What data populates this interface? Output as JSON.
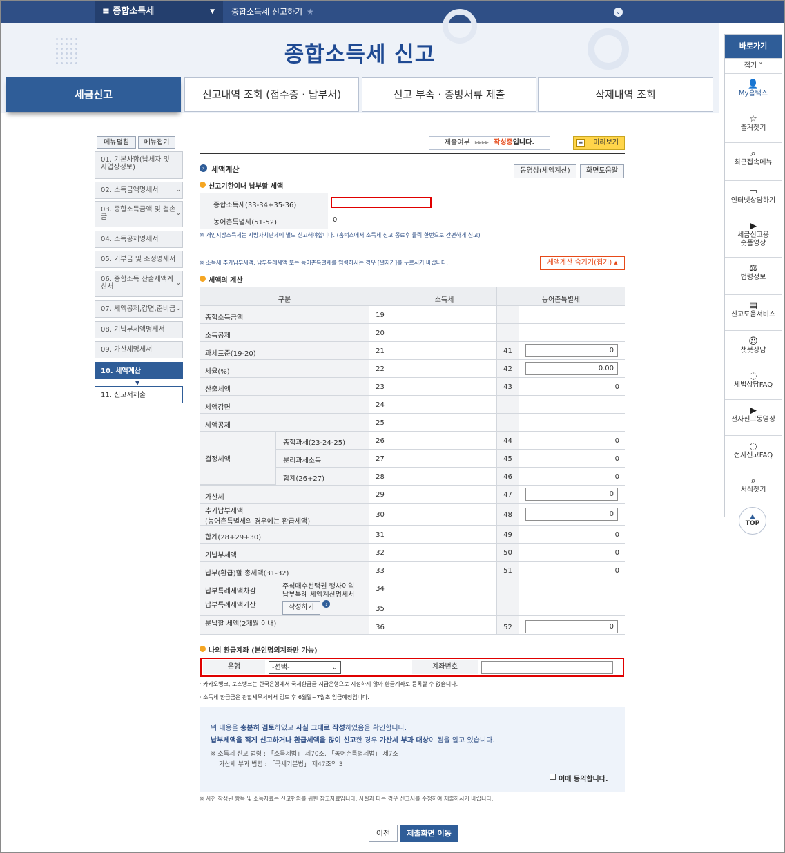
{
  "topbar": {
    "menu": "종합소득세",
    "crumb": "종합소득세 신고하기"
  },
  "title": "종합소득세 신고",
  "tabs": [
    "세금신고",
    "신고내역 조회 (접수증 · 납부서)",
    "신고 부속 · 증빙서류 제출",
    "삭제내역 조회"
  ],
  "side_buttons": {
    "edit": "메뉴펼침",
    "fold": "메뉴접기"
  },
  "side_items": [
    "01. 기본사항(납세자 및 사업장정보)",
    "02. 소득금액명세서",
    "03. 종합소득금액 및 결손금",
    "04. 소득공제명세서",
    "05. 기부금 및 조정명세서",
    "06. 종합소득 산출세액계산서",
    "07. 세액공제,감면,준비금",
    "08. 기납부세액명세서",
    "09. 가산세명세서",
    "10. 세액계산",
    "11. 신고서제출"
  ],
  "status": {
    "label": "제출여부",
    "arrows": "▸▸▸▸",
    "state": "작성중",
    "suffix": "입니다.",
    "preview": "미리보기"
  },
  "section": {
    "title": "세액계산",
    "video_btn": "동영상(세액계산)",
    "help_btn": "화면도움말"
  },
  "due": {
    "title": "신고기한이내 납부할 세액",
    "rows": [
      {
        "label": "종합소득세(33-34+35-36)",
        "value": ""
      },
      {
        "label": "농어촌특별세(51-52)",
        "value": "0"
      }
    ],
    "note": "※ 개인지방소득세는 지방자치단체에 별도 신고해야합니다. (홈택스에서 소득세 신고 종료후 클릭 한번으로 간편하게 신고)"
  },
  "calc_note": "※ 소득세 추가납부세액, 납부특례세액 또는 농어촌특별세를 입력하시는 경우 [펼치기]를 누르시기 바랍니다.",
  "hide_btn": "세액계산 숨기기(접기) ▴",
  "calc": {
    "title": "세액의 계산",
    "headers": [
      "구분",
      "소득세",
      "농어촌특별세"
    ],
    "rows": [
      {
        "label": "종합소득금액",
        "no": "19"
      },
      {
        "label": "소득공제",
        "no": "20"
      },
      {
        "label": "과세표준(19-20)",
        "no": "21",
        "rno": "41",
        "rinput": "0"
      },
      {
        "label": "세율(%)",
        "no": "22",
        "rno": "42",
        "rinput": "0.00"
      },
      {
        "label": "산출세액",
        "no": "23",
        "rno": "43",
        "rval": "0"
      },
      {
        "label": "세액감면",
        "no": "24"
      },
      {
        "label": "세액공제",
        "no": "25"
      },
      {
        "sub": "종합과세(23-24-25)",
        "no": "26",
        "rno": "44",
        "rval": "0"
      },
      {
        "sub": "분리과세소득",
        "no": "27",
        "rno": "45",
        "rval": "0"
      },
      {
        "sub": "합계(26+27)",
        "no": "28",
        "rno": "46",
        "rval": "0"
      },
      {
        "label": "가산세",
        "no": "29",
        "rno": "47",
        "rinput": "0"
      },
      {
        "label": "추가납부세액\n(농어촌특별세의 경우에는 환급세액)",
        "no": "30",
        "rno": "48",
        "rinput": "0"
      },
      {
        "label": "합계(28+29+30)",
        "no": "31",
        "rno": "49",
        "rval": "0"
      },
      {
        "label": "기납부세액",
        "no": "32",
        "rno": "50",
        "rval": "0"
      },
      {
        "label": "납부(환급)할 총세액(31-32)",
        "no": "33",
        "rno": "51",
        "rval": "0"
      },
      {
        "label": "납부특례세액차감",
        "no": "34"
      },
      {
        "label": "납부특례세액가산",
        "no": "35"
      },
      {
        "label": "분납할 세액(2개월 이내)",
        "no": "36",
        "rno": "52",
        "rinput": "0"
      }
    ],
    "group_label": "결정세액",
    "special_text": "주식매수선택권 행사이익\n납부특례 세액계산명세서",
    "special_btn": "작성하기"
  },
  "refund": {
    "title": "나의 환급계좌 (본인명의계좌만 가능)",
    "bank_label": "은행",
    "bank_value": "-선택-",
    "account_label": "계좌번호",
    "account_value": "",
    "notes": [
      "· 카카오뱅크, 토스뱅크는 한국은행에서 국세환급금 지급은행으로 지정하지 않아 환급계좌로 등록할 수 없습니다.",
      "· 소득세 환급금은 관할세무서에서 검토 후 6월말~7월초 입금예정입니다."
    ]
  },
  "confirm": {
    "line1_a": "위 내용을 ",
    "line1_b": "충분히 검토",
    "line1_c": "하였고 ",
    "line1_d": "사실 그대로 작성",
    "line1_e": "하였음을 확인합니다.",
    "line2_a": "납부세액을 적게 신고하거나 환급세액을 많이 신고",
    "line2_b": "한 경우 ",
    "line2_c": "가산세 부과 대상",
    "line2_d": "이 됨을 알고 있습니다.",
    "law1": "※ 소득세 신고 법령 : 「소득세법」 제70조, 「농어촌특별세법」 제7조",
    "law2": "가산세 부과 법령 : 「국세기본법」 제47조의 3",
    "agree": "이에 동의합니다."
  },
  "footnote": "※ 사전 작성된 항목 및 소득자료는 신고편의를 위한 참고자료입니다. 사실과 다른 경우 신고서를 수정하여 제출하시기 바랍니다.",
  "buttons": {
    "prev": "이전",
    "submit": "제출화면 이동"
  },
  "right_panel": {
    "title": "바로가기",
    "fold": "접기 ˅",
    "items": [
      {
        "icon": "user-icon",
        "label": "My홈택스"
      },
      {
        "icon": "star-icon",
        "label": "즐겨찾기"
      },
      {
        "icon": "recent-menu-icon",
        "label": "최근접속메뉴"
      },
      {
        "icon": "monitor-icon",
        "label": "인터넷상담하기"
      },
      {
        "icon": "play-icon",
        "label": "세금신고용\n숏폼영상"
      },
      {
        "icon": "gavel-icon",
        "label": "법령정보"
      },
      {
        "icon": "book-icon",
        "label": "신고도움서비스"
      },
      {
        "icon": "chatbot-icon",
        "label": "챗봇상담"
      },
      {
        "icon": "chat-icon",
        "label": "세법상담FAQ"
      },
      {
        "icon": "play-icon",
        "label": "전자신고동영상"
      },
      {
        "icon": "chat-icon",
        "label": "전자신고FAQ"
      },
      {
        "icon": "search-icon",
        "label": "서식찾기"
      }
    ],
    "top": "TOP"
  },
  "colors": {
    "accent": "#2f5d98",
    "dark": "#2f4f86",
    "highlight": "#e00000",
    "status": "#e64a19"
  }
}
